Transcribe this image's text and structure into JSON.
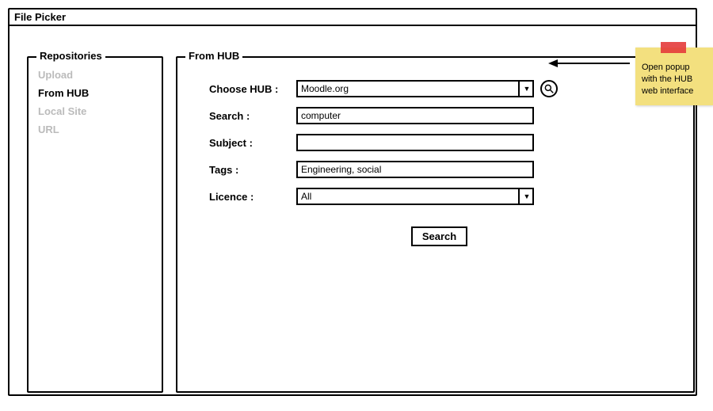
{
  "window": {
    "title": "File Picker"
  },
  "sidebar": {
    "legend": "Repositories",
    "items": [
      {
        "label": "Upload",
        "active": false
      },
      {
        "label": "From HUB",
        "active": true
      },
      {
        "label": "Local Site",
        "active": false
      },
      {
        "label": "URL",
        "active": false
      }
    ]
  },
  "main": {
    "legend": "From HUB",
    "fields": {
      "choose_hub": {
        "label": "Choose HUB :",
        "value": "Moodle.org"
      },
      "search": {
        "label": "Search :",
        "value": "computer"
      },
      "subject": {
        "label": "Subject :",
        "value": ""
      },
      "tags": {
        "label": "Tags :",
        "value": "Engineering, social"
      },
      "licence": {
        "label": "Licence :",
        "value": "All"
      }
    },
    "search_button": "Search"
  },
  "annotation": {
    "sticky_text": "Open popup with the HUB web interface"
  }
}
